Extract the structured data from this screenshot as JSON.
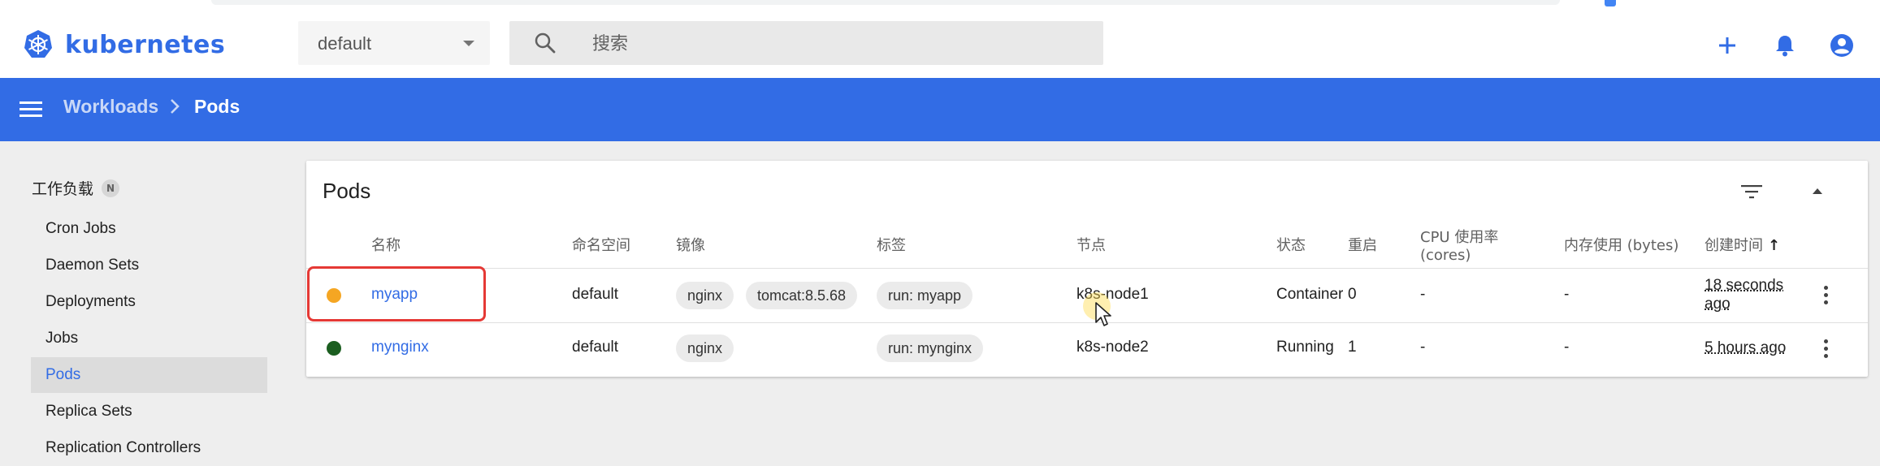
{
  "app": {
    "brand": "kubernetes",
    "brand_color": "#326ce5"
  },
  "toolbar": {
    "namespace_value": "default",
    "search_placeholder": "搜索",
    "actions": [
      "plus-icon",
      "bell-icon",
      "account-icon"
    ]
  },
  "breadcrumb": {
    "parent": "Workloads",
    "separator": ">",
    "current": "Pods"
  },
  "sidebar": {
    "section_title": "工作负载",
    "section_badge": "N",
    "items": [
      {
        "label": "Cron Jobs"
      },
      {
        "label": "Daemon Sets"
      },
      {
        "label": "Deployments"
      },
      {
        "label": "Jobs"
      },
      {
        "label": "Pods",
        "active": true
      },
      {
        "label": "Replica Sets"
      },
      {
        "label": "Replication Controllers"
      }
    ]
  },
  "pods": {
    "title": "Pods",
    "columns": {
      "name": "名称",
      "namespace": "命名空间",
      "images": "镜像",
      "labels": "标签",
      "node": "节点",
      "status": "状态",
      "restarts": "重启",
      "cpu": "CPU 使用率",
      "cpu_unit": "(cores)",
      "memory": "内存使用 (bytes)",
      "created": "创建时间",
      "sort_indicator": "↑"
    },
    "rows": [
      {
        "status_color": "#f5a623",
        "name": "myapp",
        "namespace": "default",
        "image_1": "nginx",
        "image_2": "tomcat:8.5.68",
        "label": "run: myapp",
        "node": "k8s-node1",
        "status": "Container",
        "restarts": "0",
        "cpu": "-",
        "memory": "-",
        "created_line1": "18 seconds",
        "created_line2": "ago"
      },
      {
        "status_color": "#1b5e20",
        "name": "mynginx",
        "namespace": "default",
        "image_1": "nginx",
        "label": "run: mynginx",
        "node": "k8s-node2",
        "status": "Running",
        "restarts": "1",
        "cpu": "-",
        "memory": "-",
        "created_line1": "5 hours ago"
      }
    ]
  },
  "colors": {
    "header_blue": "#326ce5",
    "highlight_red": "#e53935"
  }
}
